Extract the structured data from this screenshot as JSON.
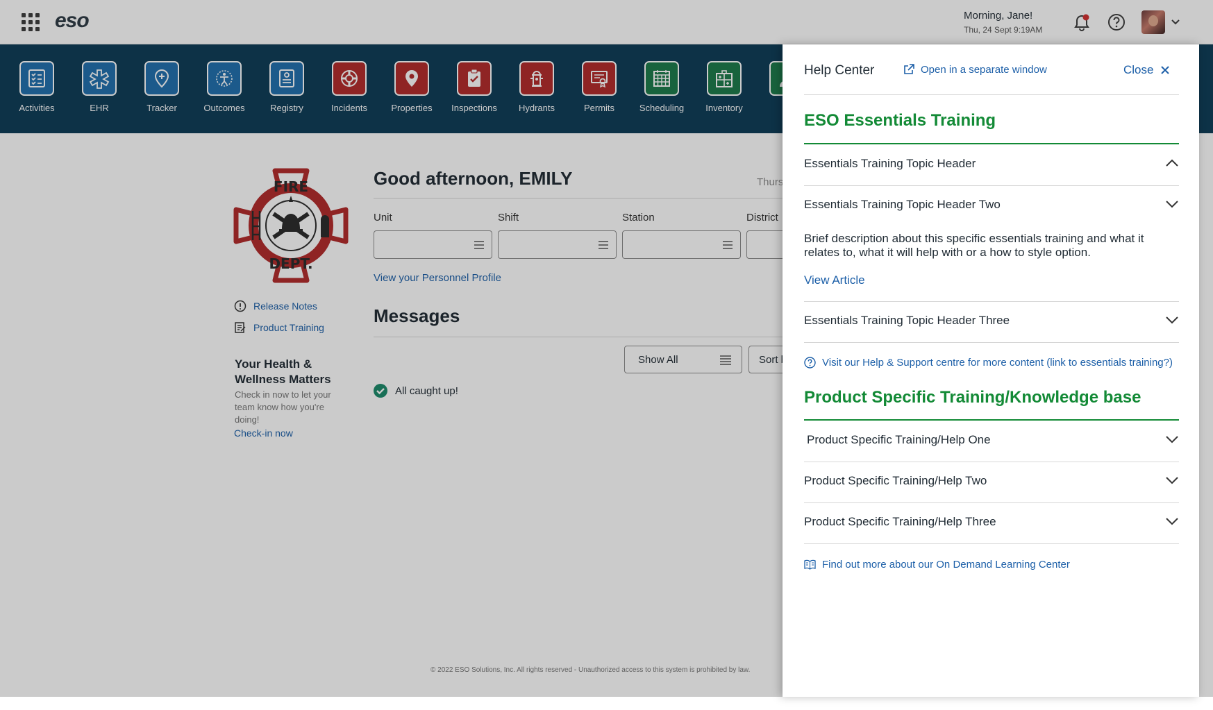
{
  "topbar": {
    "logo": "eso",
    "greeting": "Morning, Jane!",
    "datetime": "Thu, 24 Sept 9:19AM"
  },
  "apps": [
    {
      "label": "Activities",
      "color": "#1f6fae",
      "icon": "checklist-icon"
    },
    {
      "label": "EHR",
      "color": "#1f6fae",
      "icon": "medical-star-icon"
    },
    {
      "label": "Tracker",
      "color": "#1f6fae",
      "icon": "location-plus-icon"
    },
    {
      "label": "Outcomes",
      "color": "#1f6fae",
      "icon": "figure-icon"
    },
    {
      "label": "Registry",
      "color": "#1f6fae",
      "icon": "registry-icon"
    },
    {
      "label": "Incidents",
      "color": "#b22a2a",
      "icon": "fire-badge-icon"
    },
    {
      "label": "Properties",
      "color": "#b22a2a",
      "icon": "map-pin-icon"
    },
    {
      "label": "Inspections",
      "color": "#b22a2a",
      "icon": "clipboard-check-icon"
    },
    {
      "label": "Hydrants",
      "color": "#b22a2a",
      "icon": "hydrant-icon"
    },
    {
      "label": "Permits",
      "color": "#b22a2a",
      "icon": "certificate-icon"
    },
    {
      "label": "Scheduling",
      "color": "#1a7a4a",
      "icon": "calendar-grid-icon"
    },
    {
      "label": "Inventory",
      "color": "#1a7a4a",
      "icon": "inventory-icon"
    },
    {
      "label": "",
      "color": "#1a7a4a",
      "icon": "person-icon"
    }
  ],
  "main": {
    "badge_top": "FIRE",
    "badge_bottom": "DEPT.",
    "release_notes": "Release Notes",
    "product_training": "Product Training",
    "wellness_title": "Your Health & Wellness Matters",
    "wellness_text": "Check in now to let your team know how you're doing!",
    "wellness_link": "Check-in now",
    "greeting": "Good afternoon, EMILY",
    "date_partial": "Thurs",
    "filters": [
      "Unit",
      "Shift",
      "Station",
      "District"
    ],
    "profile_link": "View your Personnel Profile",
    "messages_title": "Messages",
    "show_all": "Show All",
    "sort": "Sort b",
    "caught_up": "All caught up!",
    "footer": "© 2022 ESO Solutions, Inc. All rights reserved - Unauthorized access to this system is prohibited by law."
  },
  "help": {
    "title": "Help Center",
    "open_separate": "Open in a separate window",
    "close": "Close",
    "section1_title": "ESO Essentials Training",
    "section1_items": [
      "Essentials Training Topic Header",
      "Essentials Training Topic Header Two",
      "Essentials Training Topic Header Three"
    ],
    "expanded_description": "Brief description about this specific essentials training and what it relates to, what it will help with or a how to style option.",
    "view_article": "View Article",
    "support_link": "Visit our Help & Support centre for more content (link to essentials training?)",
    "section2_title": "Product Specific Training/Knowledge base",
    "section2_items": [
      "Product Specific Training/Help One",
      "Product Specific Training/Help Two",
      "Product Specific Training/Help Three"
    ],
    "learning_link": "Find out more about our On Demand Learning Center"
  },
  "colors": {
    "accent_blue": "#1c5fa8",
    "section_green": "#138a36",
    "nav_bar": "#0c3b57",
    "notification_dot": "#d32f2f"
  }
}
